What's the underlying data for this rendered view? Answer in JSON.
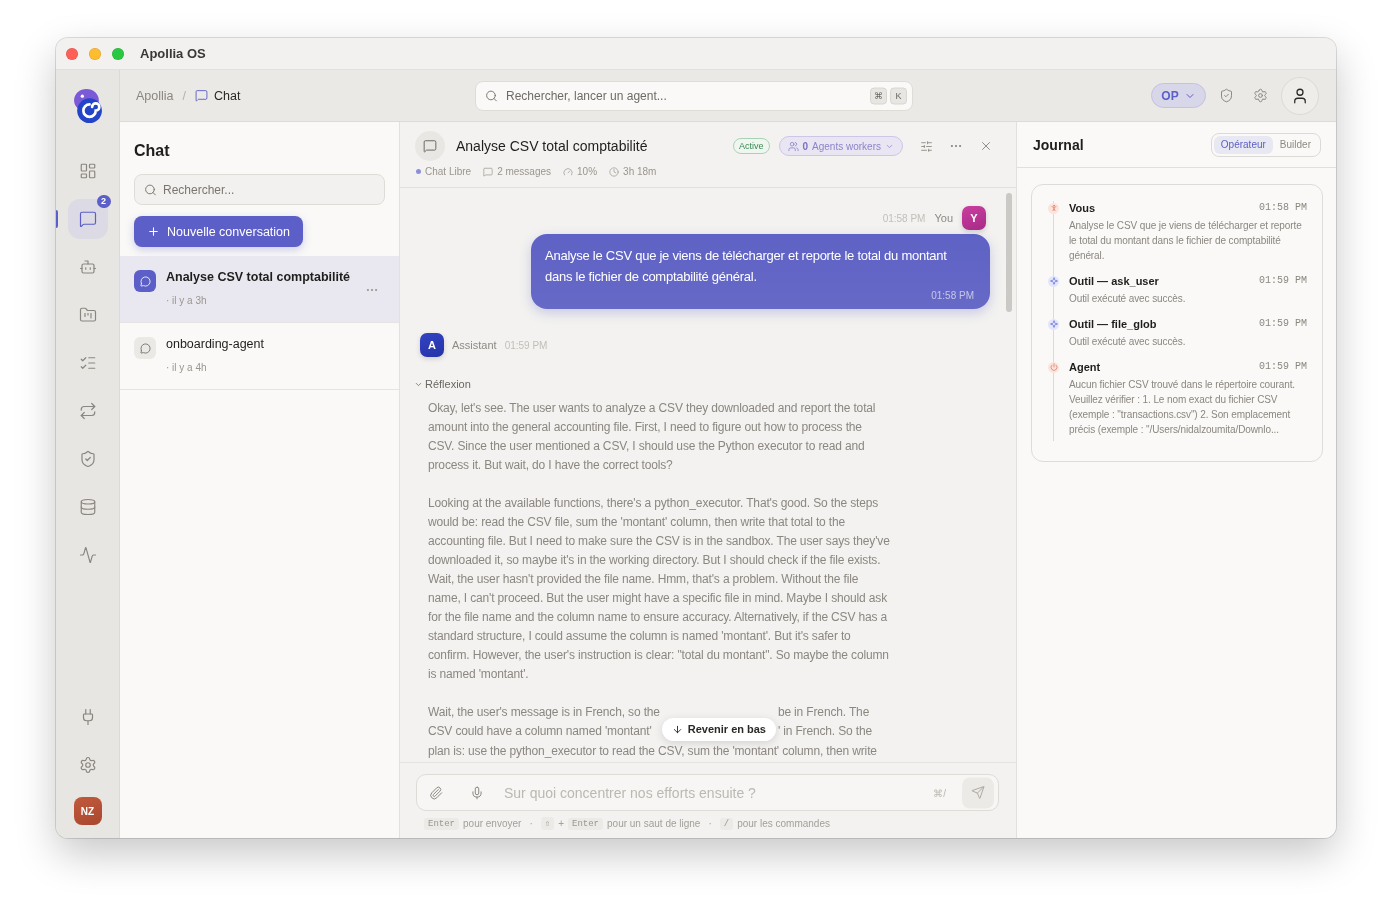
{
  "window": {
    "title": "Apollia OS"
  },
  "nav_rail": {
    "items": [
      {
        "selected": false
      },
      {
        "selected": true,
        "badge": "2"
      },
      {
        "selected": false
      },
      {
        "selected": false
      },
      {
        "selected": false
      },
      {
        "selected": false
      },
      {
        "selected": false
      },
      {
        "selected": false
      },
      {
        "selected": false
      }
    ],
    "bottom_items": [
      {
        "selected": false
      },
      {
        "selected": false
      }
    ],
    "avatar": "NZ"
  },
  "top_bar": {
    "breadcrumb": {
      "separator": "/",
      "items": [
        "Apollia",
        "Chat"
      ]
    },
    "search": {
      "placeholder": "Rechercher, lancer un agent...",
      "keys": [
        "⌘",
        "K"
      ]
    },
    "role_menu": "OP"
  },
  "chat_list": {
    "title": "Chat",
    "search": {
      "placeholder": "Rechercher..."
    },
    "new_button": "Nouvelle conversation",
    "conversations": [
      {
        "title": "Analyse CSV total comptabilité",
        "time": "· il y a 3h",
        "selected": true
      },
      {
        "title": "onboarding-agent",
        "time": "· il y a 4h",
        "selected": false
      }
    ]
  },
  "conversation": {
    "title": "Analyse CSV total comptabilité",
    "status": "Active",
    "agents": {
      "count": "0",
      "label": "Agents workers"
    },
    "meta": [
      "Chat Libre",
      "2 messages",
      "10%",
      "3h 18m"
    ]
  },
  "messages": [
    {
      "kind": "user",
      "time": "01:58 PM",
      "author": "You",
      "avatar": "Y",
      "text": "Analyse le CSV que je viens de télécharger et reporte le total du montant dans le fichier de comptabilité général.",
      "bubble_time": "01:58 PM"
    },
    {
      "kind": "assistant",
      "avatar": "A",
      "author": "Assistant",
      "time": "01:59 PM",
      "reasoning": {
        "label": "Réflexion",
        "expanded": true,
        "paragraphs": [
          "Okay, let's see. The user wants to analyze a CSV they downloaded and report the total amount into the general accounting file. First, I need to figure out how to process the CSV. Since the user mentioned a CSV, I should use the Python executor to read and process it. But wait, do I have the correct tools?",
          "Looking at the available functions, there's a python_executor. That's good. So the steps would be: read the CSV file, sum the 'montant' column, then write that total to the accounting file. But I need to make sure the CSV is in the sandbox. The user says they've downloaded it, so maybe it's in the working directory. But I should check if the file exists. Wait, the user hasn't provided the file name. Hmm, that's a problem. Without the file name, I can't proceed. But the user might have a specific file in mind. Maybe I should ask for the file name and the column name to ensure accuracy. Alternatively, if the CSV has a standard structure, I could assume the column is named 'montant'. But it's safer to confirm. However, the user's instruction is clear: \"total du montant\". So maybe the column is named 'montant'."
        ],
        "continuation": [
          {
            "left": "Wait, the user's message is in French, so the",
            "right": "be in French. The"
          },
          {
            "left": "CSV could have a column named 'montant'",
            "right": "' in French. So the"
          },
          {
            "left": "plan is: use the python_executor to read the CSV, sum the 'montant' column, then write"
          }
        ]
      }
    }
  ],
  "jump_button": "Revenir en bas",
  "composer": {
    "placeholder": "Sur quoi concentrer nos efforts ensuite ?",
    "shortcut": "⌘/",
    "hints": {
      "separator": "·",
      "items": [
        {
          "keys": [
            "Enter"
          ],
          "text": "pour envoyer"
        },
        {
          "keys": [
            "⇧",
            "Enter"
          ],
          "joiner": "+",
          "text": "pour un saut de ligne"
        },
        {
          "keys": [
            "/"
          ],
          "text": "pour les commandes"
        }
      ]
    }
  },
  "journal": {
    "title": "Journal",
    "modes": [
      {
        "label": "Opérateur",
        "selected": true
      },
      {
        "label": "Builder",
        "selected": false
      }
    ],
    "entries": [
      {
        "kind": "user",
        "title": "Vous",
        "time": "01:58 PM",
        "text": "Analyse le CSV que je viens de télécharger et reporte le total du montant dans le fichier de comptabilité général."
      },
      {
        "kind": "tool",
        "title": "Outil — ask_user",
        "time": "01:59 PM",
        "text": "Outil exécuté avec succès."
      },
      {
        "kind": "tool",
        "title": "Outil — file_glob",
        "time": "01:59 PM",
        "text": "Outil exécuté avec succès."
      },
      {
        "kind": "agent",
        "title": "Agent",
        "time": "01:59 PM",
        "text": "Aucun fichier CSV trouvé dans le répertoire courant. Veuillez vérifier : 1. Le nom exact du fichier CSV (exemple : \"transactions.csv\") 2. Son emplacement précis (exemple : \"/Users/nidalzoumita/Downlo..."
      }
    ]
  }
}
